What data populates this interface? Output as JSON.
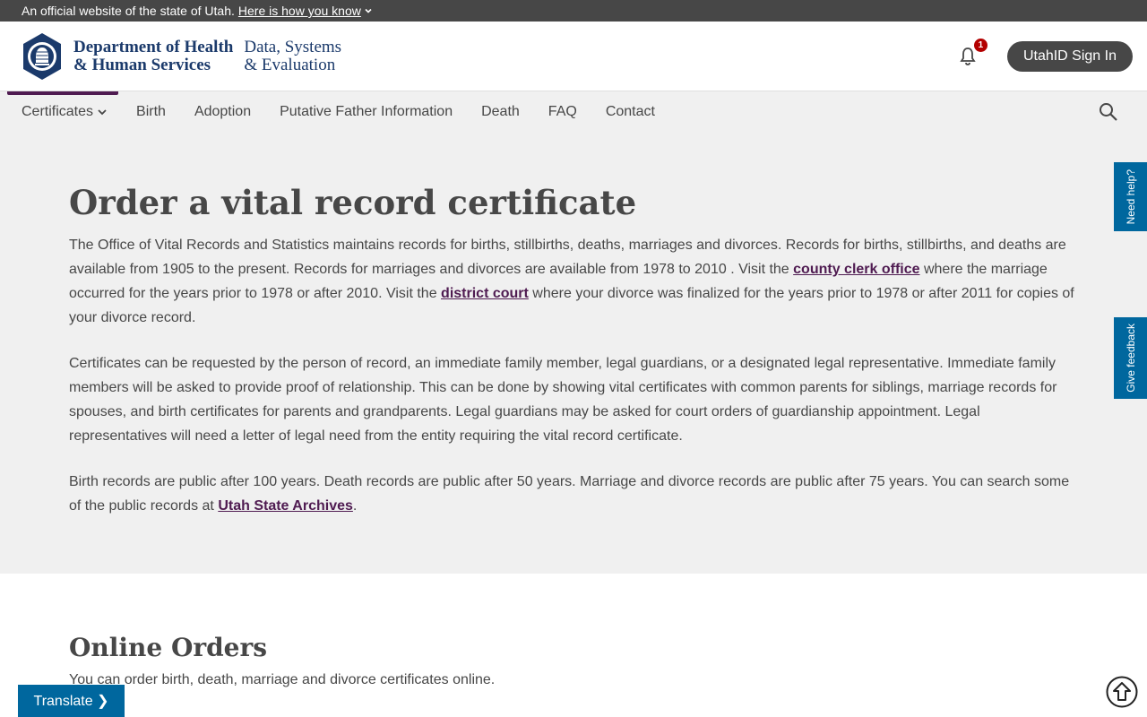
{
  "official_bar": {
    "text": "An official website of the state of Utah.",
    "link": "Here is how you know"
  },
  "header": {
    "dept_line1": "Department of Health",
    "dept_line2": "& Human Services",
    "division_line1": "Data, Systems",
    "division_line2": "& Evaluation",
    "notification_count": "1",
    "signin_label": "UtahID Sign In"
  },
  "nav": {
    "items": [
      "Certificates",
      "Birth",
      "Adoption",
      "Putative Father Information",
      "Death",
      "FAQ",
      "Contact"
    ]
  },
  "hero": {
    "title": "Order a vital record certificate",
    "p1": {
      "t1": "The Office of Vital Records and Statistics maintains records for births, stillbirths, deaths, marriages and divorces. Records for births, stillbirths, and deaths are available from 1905 to the present. Records for marriages and divorces are available from 1978 to 2010 . Visit the ",
      "link1": "county clerk office",
      "t2": " where the marriage occurred for the years prior to 1978 or after 2010. Visit the ",
      "link2": "district court",
      "t3": " where your divorce was finalized for the years prior to 1978 or after 2011 for copies of your divorce record."
    },
    "p2": "Certificates can be requested by the person of record, an immediate family member, legal guardians, or a designated legal representative. Immediate family members will be asked to provide proof of relationship. This can be done by showing vital certificates with common parents for siblings, marriage records for spouses, and birth certificates for parents and grandparents. Legal guardians may be asked for court orders of guardianship appointment. Legal representatives will need a letter of legal need from the entity requiring the vital record certificate.",
    "p3": {
      "t1": "Birth records are public after 100 years. Death records are public after 50 years. Marriage and divorce records are public after 75 years. You can search some of the public records at ",
      "link": "Utah State Archives",
      "t2": "."
    }
  },
  "online": {
    "title": "Online Orders",
    "text": "You can order birth, death, marriage and divorce certificates online."
  },
  "side_tabs": {
    "help": "Need help?",
    "feedback": "Give feedback"
  },
  "translate_label": "Translate ❯",
  "colors": {
    "accent": "#4f1b51",
    "tab_blue": "#00679e",
    "dark": "#474747",
    "navy": "#1b3a6b"
  }
}
